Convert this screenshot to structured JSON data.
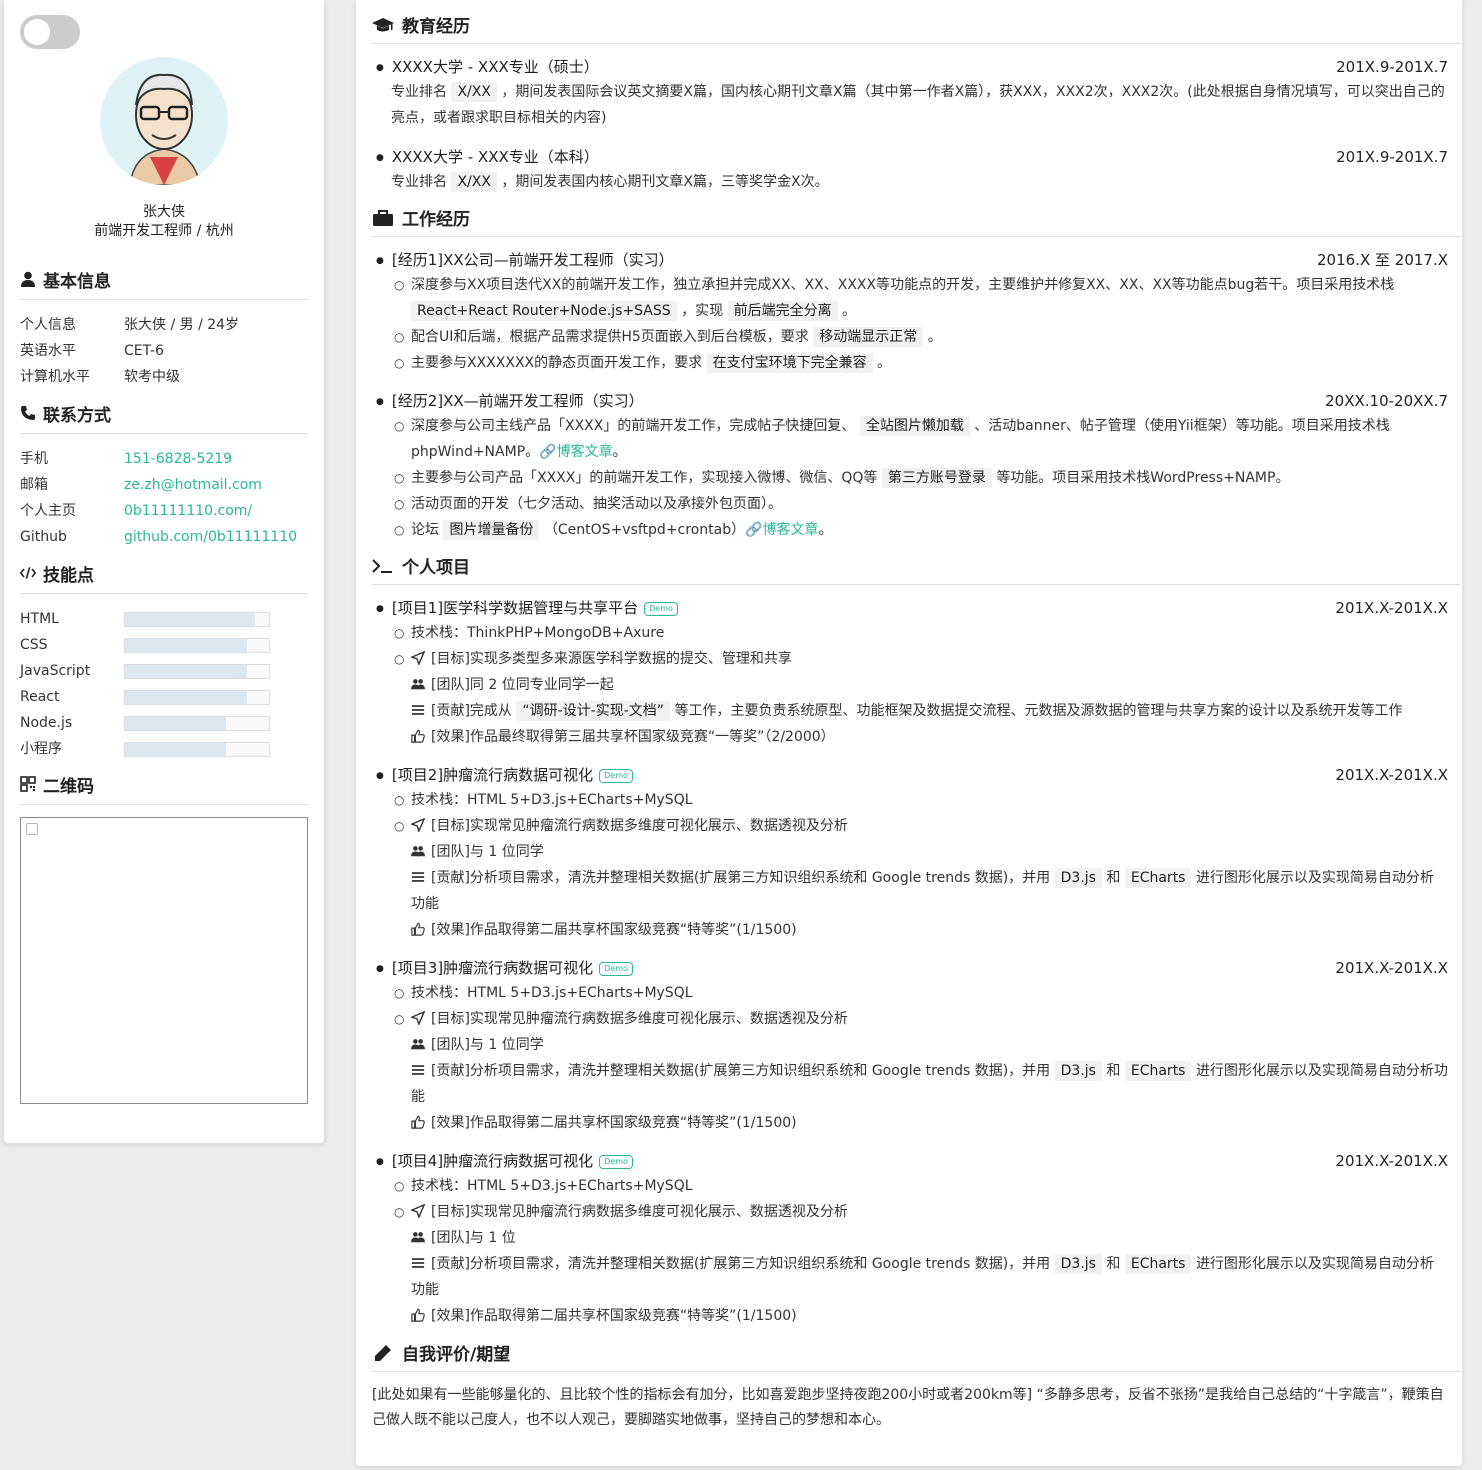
{
  "profile": {
    "name": "张大侠",
    "subtitle": "前端开发工程师 / 杭州"
  },
  "basic": {
    "title": "基本信息",
    "rows": [
      {
        "k": "个人信息",
        "v": "张大侠 / 男 / 24岁"
      },
      {
        "k": "英语水平",
        "v": "CET-6"
      },
      {
        "k": "计算机水平",
        "v": "软考中级"
      }
    ]
  },
  "contact": {
    "title": "联系方式",
    "rows": [
      {
        "k": "手机",
        "v": "151-6828-5219"
      },
      {
        "k": "邮箱",
        "v": "ze.zh@hotmail.com"
      },
      {
        "k": "个人主页",
        "v": "0b11111110.com/"
      },
      {
        "k": "Github",
        "v": "github.com/0b11111110"
      }
    ]
  },
  "skills": {
    "title": "技能点",
    "items": [
      {
        "name": "HTML",
        "level": 0.9
      },
      {
        "name": "CSS",
        "level": 0.85
      },
      {
        "name": "JavaScript",
        "level": 0.85
      },
      {
        "name": "React",
        "level": 0.85
      },
      {
        "name": "Node.js",
        "level": 0.7
      },
      {
        "name": "小程序",
        "level": 0.7
      }
    ]
  },
  "qrcode": {
    "title": "二维码"
  },
  "education": {
    "title": "教育经历",
    "items": [
      {
        "name": "XXXX大学 - XXX专业（硕士）",
        "date": "201X.9-201X.7",
        "pre": "专业排名",
        "rank": "X/XX",
        "post": "，期间发表国际会议英文摘要X篇，国内核心期刊文章X篇（其中第一作者X篇），获XXX，XXX2次，XXX2次。(此处根据自身情况填写，可以突出自己的亮点，或者跟求职目标相关的内容)"
      },
      {
        "name": "XXXX大学 - XXX专业（本科）",
        "date": "201X.9-201X.7",
        "pre": "专业排名",
        "rank": "X/XX",
        "post": "，期间发表国内核心期刊文章X篇，三等奖学金X次。"
      }
    ]
  },
  "work": {
    "title": "工作经历",
    "job1": {
      "name": "[经历1]XX公司—前端开发工程师（实习）",
      "date": "2016.X 至 2017.X",
      "l1a": "深度参与XX项目迭代XX的前端开发工作，独立承担并完成XX、XX、XXXX等功能点的开发，主要维护并修复XX、XX、XX等功能点bug若干。项目采用技术栈",
      "l1code": "React+React Router+Node.js+SASS",
      "l1b": "，实现",
      "l1code2": "前后端完全分离",
      "l1c": "。",
      "l2a": "配合UI和后端，根据产品需求提供H5页面嵌入到后台模板，要求",
      "l2code": "移动端显示正常",
      "l2b": "。",
      "l3a": "主要参与XXXXXXX的静态页面开发工作，要求",
      "l3code": "在支付宝环境下完全兼容",
      "l3b": "。"
    },
    "job2": {
      "name": "[经历2]XX—前端开发工程师（实习）",
      "date": "20XX.10-20XX.7",
      "l1a": "深度参与公司主线产品「XXXX」的前端开发工作，完成帖子快捷回复、",
      "l1code": "全站图片懒加载",
      "l1b": "、活动banner、帖子管理（使用Yii框架）等功能。项目采用技术栈phpWind+NAMP。",
      "l1link": "博客文章",
      "l1c": "。",
      "l2a": "主要参与公司产品「XXXX」的前端开发工作，实现接入微博、微信、QQ等",
      "l2code": "第三方账号登录",
      "l2b": "等功能。项目采用技术栈WordPress+NAMP。",
      "l3": "活动页面的开发（七夕活动、抽奖活动以及承接外包页面）。",
      "l4a": "论坛",
      "l4code": "图片增量备份",
      "l4b": "（CentOS+vsftpd+crontab）",
      "l4link": "博客文章",
      "l4c": "。"
    }
  },
  "projects": {
    "title": "个人项目",
    "badge": "Demo",
    "p1": {
      "name": "[项目1]医学科学数据管理与共享平台",
      "date": "201X.X-201X.X",
      "stack": "技术栈：ThinkPHP+MongoDB+Axure",
      "goal": "[目标]实现多类型多来源医学科学数据的提交、管理和共享",
      "team": "[团队]同 2 位同专业同学一起",
      "contribA": "[贡献]完成从",
      "contribCode": "“调研-设计-实现-文档”",
      "contribB": "等工作，主要负责系统原型、功能框架及数据提交流程、元数据及源数据的管理与共享方案的设计以及系统开发等工作",
      "effect": "[效果]作品最终取得第三届共享杯国家级竞赛“一等奖”（2/2000）"
    },
    "p2": {
      "name": "[项目2]肿瘤流行病数据可视化",
      "date": "201X.X-201X.X",
      "stack": "技术栈：HTML 5+D3.js+ECharts+MySQL",
      "goal": "[目标]实现常见肿瘤流行病数据多维度可视化展示、数据透视及分析",
      "team": "[团队]与 1 位同学",
      "contribA": "[贡献]分析项目需求，清洗并整理相关数据(扩展第三方知识组织系统和 Google trends 数据)，并用",
      "c1": "D3.js",
      "and": "和",
      "c2": "ECharts",
      "contribB": "进行图形化展示以及实现简易自动分析 功能",
      "effect": "[效果]作品取得第二届共享杯国家级竞赛“特等奖”(1/1500)"
    },
    "p3": {
      "name": "[项目3]肿瘤流行病数据可视化",
      "date": "201X.X-201X.X",
      "stack": "技术栈：HTML 5+D3.js+ECharts+MySQL",
      "goal": "[目标]实现常见肿瘤流行病数据多维度可视化展示、数据透视及分析",
      "team": "[团队]与 1 位同学",
      "contribA": "[贡献]分析项目需求，清洗并整理相关数据(扩展第三方知识组织系统和 Google trends 数据)，并用",
      "c1": "D3.js",
      "and": "和",
      "c2": "ECharts",
      "contribB": "进行图形化展示以及实现简易自动分析功能",
      "effect": "[效果]作品取得第二届共享杯国家级竞赛“特等奖”(1/1500)"
    },
    "p4": {
      "name": "[项目4]肿瘤流行病数据可视化",
      "date": "201X.X-201X.X",
      "stack": "技术栈：HTML 5+D3.js+ECharts+MySQL",
      "goal": "[目标]实现常见肿瘤流行病数据多维度可视化展示、数据透视及分析",
      "team": "[团队]与 1 位",
      "contribA": "[贡献]分析项目需求，清洗并整理相关数据(扩展第三方知识组织系统和 Google trends 数据)，并用",
      "c1": "D3.js",
      "and": "和",
      "c2": "ECharts",
      "contribB": "进行图形化展示以及实现简易自动分析 功能",
      "effect": "[效果]作品取得第二届共享杯国家级竞赛“特等奖”(1/1500)"
    }
  },
  "self": {
    "title": "自我评价/期望",
    "text": "[此处如果有一些能够量化的、且比较个性的指标会有加分，比如喜爱跑步坚持夜跑200小时或者200km等] “多静多思考，反省不张扬”是我给自己总结的“十字箴言”，鞭策自己做人既不能以己度人，也不以人观己，要脚踏实地做事，坚持自己的梦想和本心。"
  }
}
